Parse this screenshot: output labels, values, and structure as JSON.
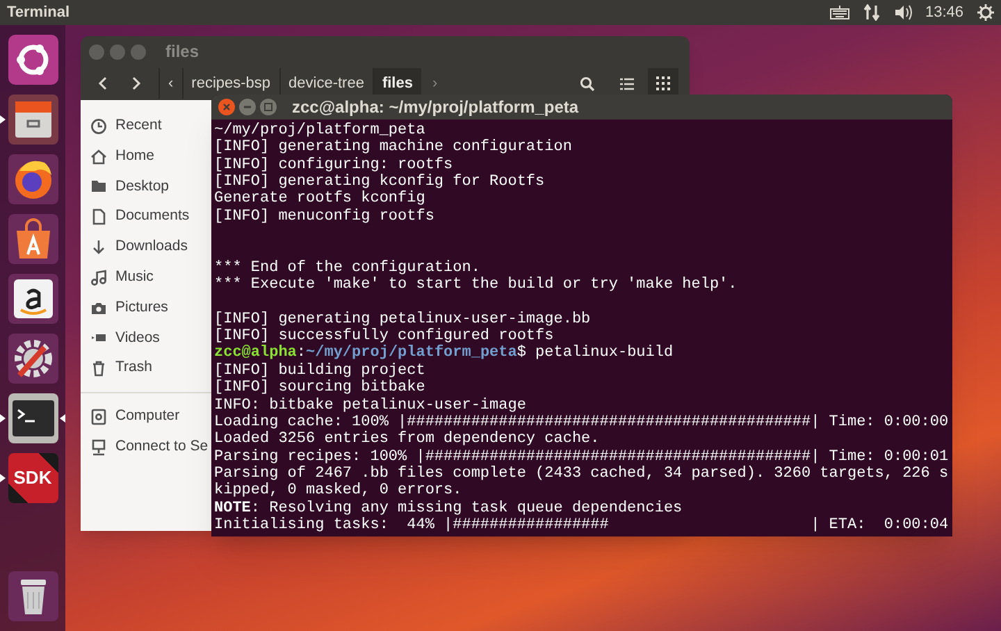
{
  "top_bar": {
    "title": "Terminal",
    "clock": "13:46"
  },
  "launcher": [
    {
      "kind": "dash",
      "running": false,
      "focused": false
    },
    {
      "kind": "files",
      "running": true,
      "focused": false
    },
    {
      "kind": "firefox",
      "running": false,
      "focused": false
    },
    {
      "kind": "software",
      "running": false,
      "focused": false
    },
    {
      "kind": "amazon",
      "running": false,
      "focused": false
    },
    {
      "kind": "settings",
      "running": false,
      "focused": false
    },
    {
      "kind": "terminal",
      "running": true,
      "focused": true
    },
    {
      "kind": "sdk",
      "running": true,
      "focused": false,
      "label": "SDK"
    },
    {
      "kind": "trash",
      "running": false,
      "focused": false
    }
  ],
  "files_window": {
    "title": "files",
    "path_bar": {
      "left_arrow": "‹",
      "crumbs": [
        {
          "label": "recipes-bsp",
          "selected": false
        },
        {
          "label": "device-tree",
          "selected": false
        },
        {
          "label": "files",
          "selected": true
        }
      ],
      "right_arrow": "›"
    },
    "sidebar": [
      {
        "kind": "recent",
        "label": "Recent"
      },
      {
        "kind": "home",
        "label": "Home"
      },
      {
        "kind": "desktop",
        "label": "Desktop"
      },
      {
        "kind": "documents",
        "label": "Documents"
      },
      {
        "kind": "downloads",
        "label": "Downloads"
      },
      {
        "kind": "music",
        "label": "Music"
      },
      {
        "kind": "pictures",
        "label": "Pictures"
      },
      {
        "kind": "videos",
        "label": "Videos"
      },
      {
        "kind": "trash",
        "label": "Trash"
      },
      {
        "kind": "divider"
      },
      {
        "kind": "computer",
        "label": "Computer"
      },
      {
        "kind": "network",
        "label": "Connect to Se"
      }
    ]
  },
  "terminal": {
    "title": "zcc@alpha: ~/my/proj/platform_peta",
    "lines": [
      {
        "kind": "plain",
        "text": "~/my/proj/platform_peta"
      },
      {
        "kind": "plain",
        "text": "[INFO] generating machine configuration"
      },
      {
        "kind": "plain",
        "text": "[INFO] configuring: rootfs"
      },
      {
        "kind": "plain",
        "text": "[INFO] generating kconfig for Rootfs"
      },
      {
        "kind": "plain",
        "text": "Generate rootfs kconfig"
      },
      {
        "kind": "plain",
        "text": "[INFO] menuconfig rootfs"
      },
      {
        "kind": "blank"
      },
      {
        "kind": "blank"
      },
      {
        "kind": "plain",
        "text": "*** End of the configuration."
      },
      {
        "kind": "plain",
        "text": "*** Execute 'make' to start the build or try 'make help'."
      },
      {
        "kind": "blank"
      },
      {
        "kind": "plain",
        "text": "[INFO] generating petalinux-user-image.bb"
      },
      {
        "kind": "plain",
        "text": "[INFO] successfully configured rootfs"
      },
      {
        "kind": "prompt",
        "user": "zcc@alpha",
        "sep": ":",
        "path": "~/my/proj/platform_peta",
        "text": "$ petalinux-build"
      },
      {
        "kind": "plain",
        "text": "[INFO] building project"
      },
      {
        "kind": "plain",
        "text": "[INFO] sourcing bitbake"
      },
      {
        "kind": "plain",
        "text": "INFO: bitbake petalinux-user-image"
      },
      {
        "kind": "plain",
        "text": "Loading cache: 100% |############################################| Time: 0:00:00"
      },
      {
        "kind": "plain",
        "text": "Loaded 3256 entries from dependency cache."
      },
      {
        "kind": "plain",
        "text": "Parsing recipes: 100% |##########################################| Time: 0:00:01"
      },
      {
        "kind": "plain",
        "text": "Parsing of 2467 .bb files complete (2433 cached, 34 parsed). 3260 targets, 226 s"
      },
      {
        "kind": "plain",
        "text": "kipped, 0 masked, 0 errors."
      },
      {
        "kind": "plain",
        "text": "**NOTE**: Resolving any missing task queue dependencies"
      },
      {
        "kind": "plain",
        "text": "Initialising tasks:  44% |#################                      | ETA:  0:00:04"
      }
    ]
  }
}
